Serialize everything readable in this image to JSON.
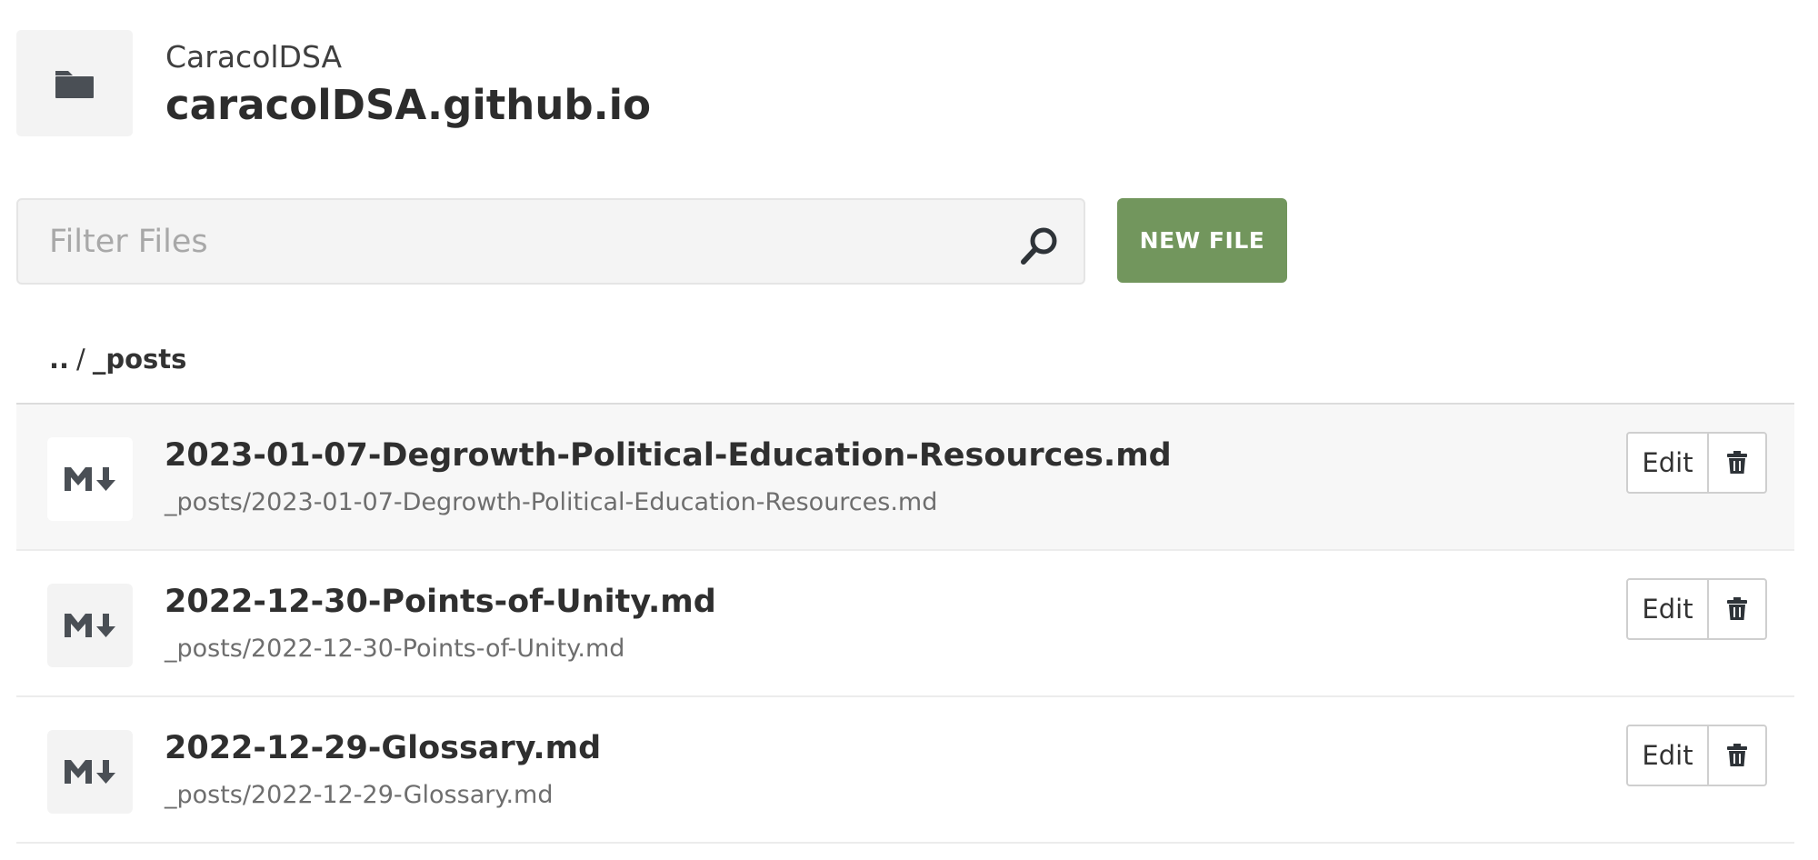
{
  "repo": {
    "owner": "CaracolDSA",
    "name": "caracolDSA.github.io",
    "icon": "folder-icon"
  },
  "search": {
    "placeholder": "Filter Files",
    "value": "",
    "icon": "search-icon"
  },
  "toolbar": {
    "new_file_label": "NEW FILE",
    "accent_color": "#72965d"
  },
  "breadcrumb": {
    "up": "..",
    "separator": "/",
    "current": "_posts"
  },
  "files": [
    {
      "name": "2023-01-07-Degrowth-Political-Education-Resources.md",
      "path": "_posts/2023-01-07-Degrowth-Political-Education-Resources.md",
      "icon": "markdown-icon",
      "edit_label": "Edit",
      "delete_icon": "trash-icon"
    },
    {
      "name": "2022-12-30-Points-of-Unity.md",
      "path": "_posts/2022-12-30-Points-of-Unity.md",
      "icon": "markdown-icon",
      "edit_label": "Edit",
      "delete_icon": "trash-icon"
    },
    {
      "name": "2022-12-29-Glossary.md",
      "path": "_posts/2022-12-29-Glossary.md",
      "icon": "markdown-icon",
      "edit_label": "Edit",
      "delete_icon": "trash-icon"
    }
  ]
}
